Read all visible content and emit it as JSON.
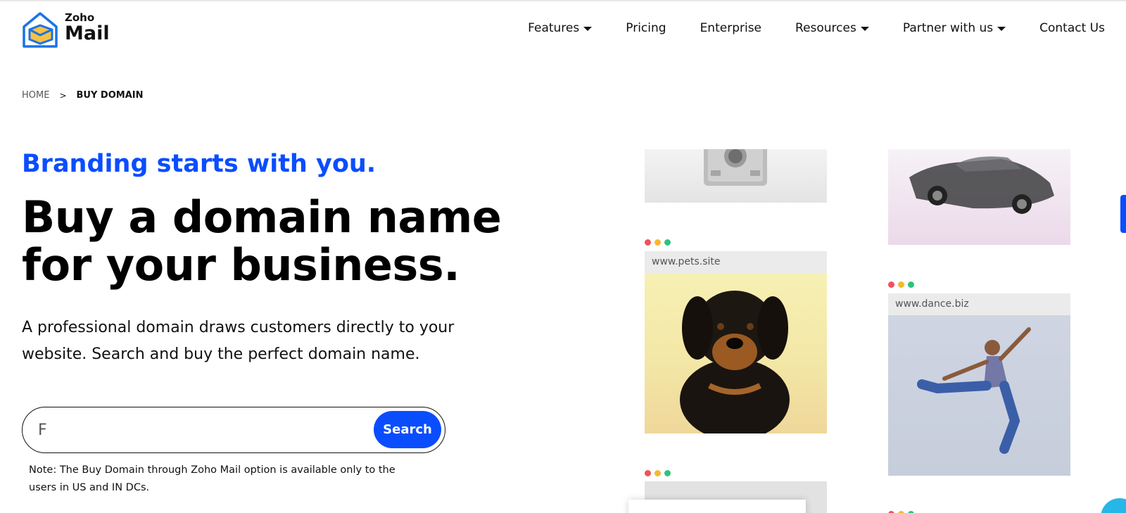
{
  "header": {
    "logo": {
      "brand": "Zoho",
      "product": "Mail"
    },
    "nav": [
      {
        "label": "Features",
        "dropdown": true
      },
      {
        "label": "Pricing",
        "dropdown": false
      },
      {
        "label": "Enterprise",
        "dropdown": false
      },
      {
        "label": "Resources",
        "dropdown": true
      },
      {
        "label": "Partner with us",
        "dropdown": true
      },
      {
        "label": "Contact Us",
        "dropdown": false
      }
    ]
  },
  "breadcrumb": {
    "home": "HOME",
    "separator": ">",
    "current": "BUY DOMAIN"
  },
  "hero": {
    "tagline": "Branding starts with you.",
    "headline": "Buy a domain name for your business.",
    "description": "A professional domain draws customers directly to your website. Search and buy the perfect domain name."
  },
  "search": {
    "value": "F",
    "button_label": "Search"
  },
  "note": "Note: The Buy Domain through Zoho Mail option is available only to the users in US and IN DCs.",
  "gallery": {
    "pets_url": "www.pets.site",
    "dance_url": "www.dance.biz"
  },
  "colors": {
    "accent": "#0a4dff",
    "tagline": "#0a4dff"
  }
}
